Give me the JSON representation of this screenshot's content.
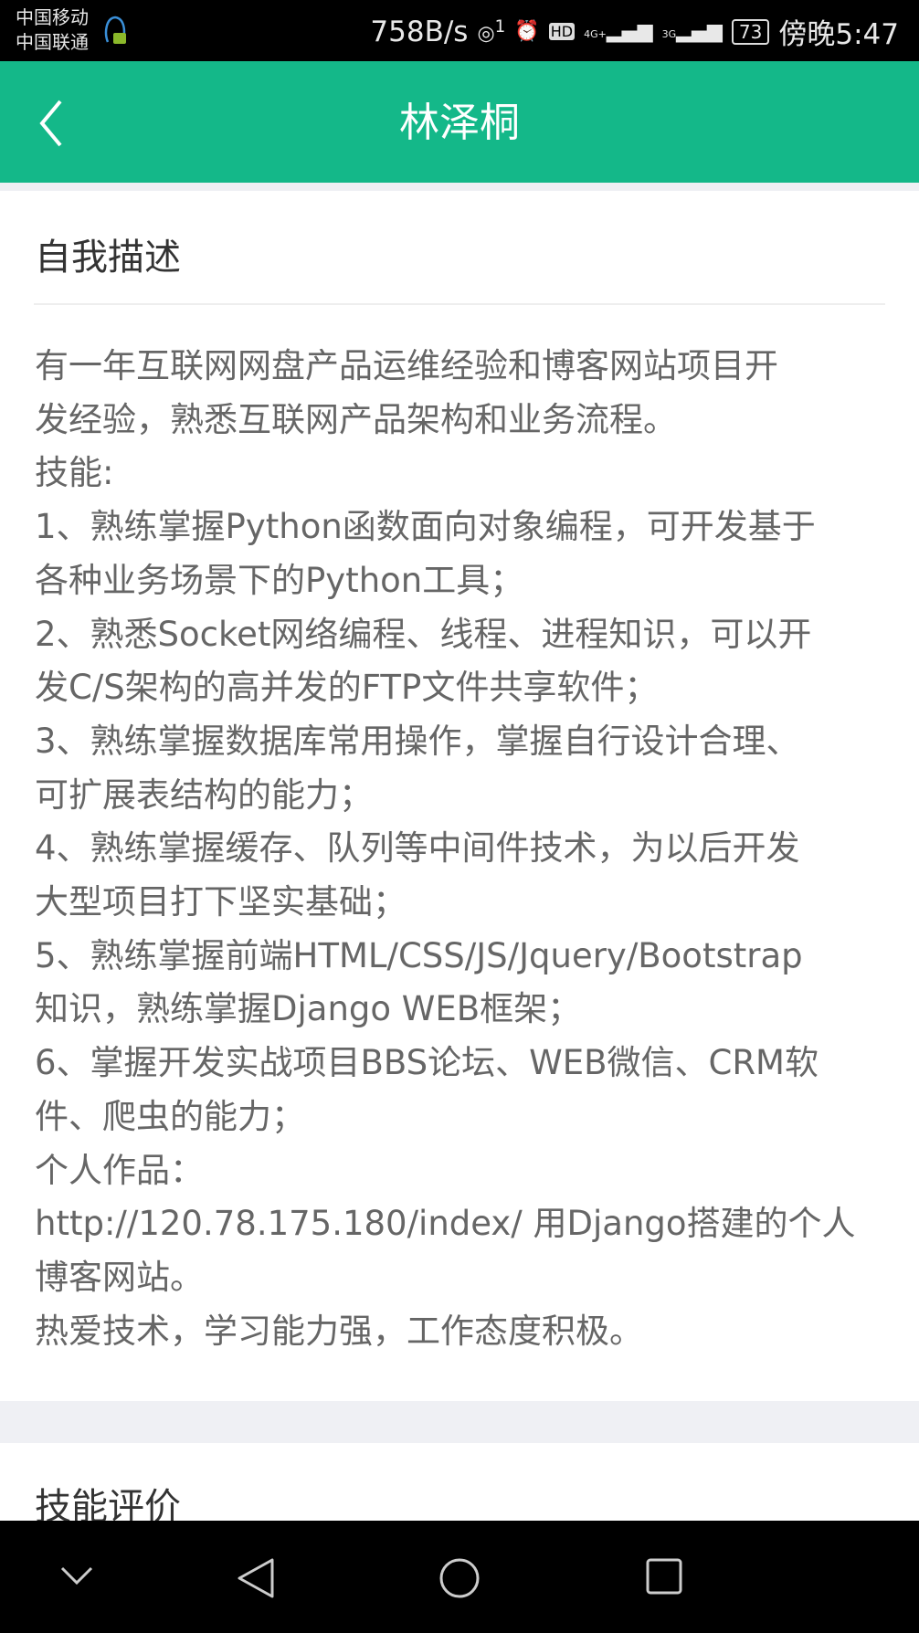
{
  "status_bar": {
    "carrier1": "中国移动",
    "carrier2": "中国联通",
    "net_speed": "758B/s",
    "hotspot": "1",
    "hd": "HD",
    "net1": "4G+",
    "net2": "3G",
    "battery": "73",
    "time": "傍晚5:47"
  },
  "header": {
    "title": "林泽桐"
  },
  "self_description": {
    "title": "自我描述",
    "lines": [
      "有一年互联网网盘产品运维经验和博客网站项目开",
      "发经验，熟悉互联网产品架构和业务流程。",
      "技能:",
      "1、熟练掌握Python函数面向对象编程，可开发基于",
      "各种业务场景下的Python工具；",
      "2、熟悉Socket网络编程、线程、进程知识，可以开",
      "发C/S架构的高并发的FTP文件共享软件；",
      "3、熟练掌握数据库常用操作，掌握自行设计合理、",
      "可扩展表结构的能力；",
      "4、熟练掌握缓存、队列等中间件技术，为以后开发",
      "大型项目打下坚实基础；",
      "5、熟练掌握前端HTML/CSS/JS/Jquery/Bootstrap",
      "知识，熟练掌握Django WEB框架；",
      "6、掌握开发实战项目BBS论坛、WEB微信、CRM软",
      "件、爬虫的能力；",
      "个人作品：",
      "http://120.78.175.180/index/ 用Django搭建的个人",
      "博客网站。",
      "热爱技术，学习能力强，工作态度积极。"
    ]
  },
  "skills": {
    "title": "技能评价"
  },
  "colors": {
    "accent": "#14b889"
  }
}
